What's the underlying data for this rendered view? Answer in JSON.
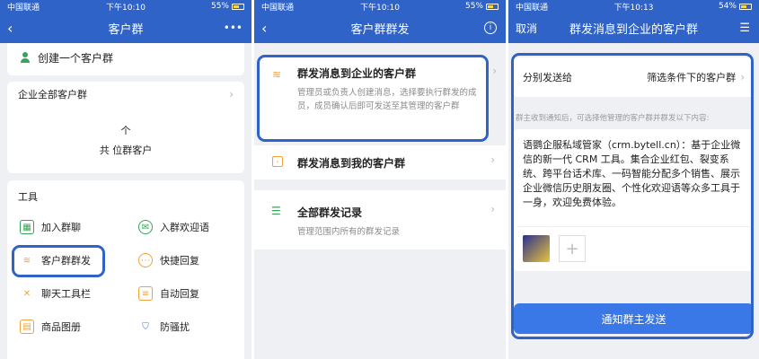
{
  "phone1": {
    "status": {
      "carrier": "中国联通",
      "time": "下午10:10",
      "battery": "55%"
    },
    "nav": {
      "title": "客户群",
      "more": "•••"
    },
    "create_group": "创建一个客户群",
    "all_groups_title": "企业全部客户群",
    "stat_line1": "个",
    "stat_line2": "共  位群客户",
    "tools_title": "工具",
    "tools": [
      {
        "label": "加入群聊"
      },
      {
        "label": "入群欢迎语"
      },
      {
        "label": "客户群群发"
      },
      {
        "label": "快捷回复"
      },
      {
        "label": "聊天工具栏"
      },
      {
        "label": "自动回复"
      },
      {
        "label": "商品图册"
      },
      {
        "label": "防骚扰"
      }
    ]
  },
  "phone2": {
    "status": {
      "carrier": "中国联通",
      "time": "下午10:10",
      "battery": "55%"
    },
    "nav": {
      "title": "客户群群发"
    },
    "items": [
      {
        "title": "群发消息到企业的客户群",
        "desc": "管理员或负责人创建消息，选择要执行群发的成员，成员确认后即可发送至其管理的客户群"
      },
      {
        "title": "群发消息到我的客户群"
      },
      {
        "title": "全部群发记录",
        "desc": "管理范围内所有的群发记录"
      }
    ]
  },
  "phone3": {
    "status": {
      "carrier": "中国联通",
      "time": "下午10:13",
      "battery": "54%"
    },
    "nav": {
      "title": "群发消息到企业的客户群",
      "cancel": "取消"
    },
    "send_to_label": "分别发送给",
    "send_to_value": "筛选条件下的客户群",
    "hint": "群主收到通知后，可选择他管理的客户群并群发以下内容:",
    "message": "语鹦企服私域管家（crm.bytell.cn）：基于企业微信的新一代 CRM 工具。集合企业红包、裂变系统、跨平台话术库、一码智能分配多个销售、展示企业微信历史朋友圈、个性化欢迎语等众多工具于一身，欢迎免费体验。",
    "add_label": "+",
    "button": "通知群主发送"
  },
  "colors": {
    "primary": "#2f63c7",
    "button": "#3b78e7",
    "bg": "#eef0f4"
  }
}
